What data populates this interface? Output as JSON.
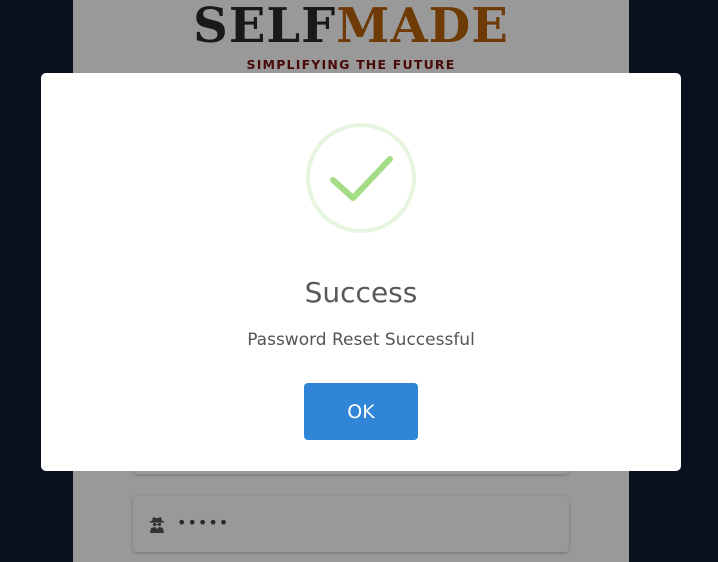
{
  "page": {
    "logo": {
      "part1": "SELF",
      "part2": "MADE",
      "tagline": "SIMPLIFYING THE FUTURE"
    },
    "form": {
      "password_value": "•••••",
      "password_icon": "user-secret-icon"
    }
  },
  "dialog": {
    "icon": "success-checkmark-icon",
    "title": "Success",
    "message": "Password Reset Successful",
    "ok_label": "OK"
  },
  "colors": {
    "background": "#0f1c33",
    "overlay": "rgba(0,0,0,0.4)",
    "accent_button": "#3085d6",
    "success_ring": "#e6f5df",
    "success_check": "#a5dc86",
    "logo_dark": "#2b2b2b",
    "logo_orange": "#b8620a",
    "tagline": "#7a1010"
  }
}
